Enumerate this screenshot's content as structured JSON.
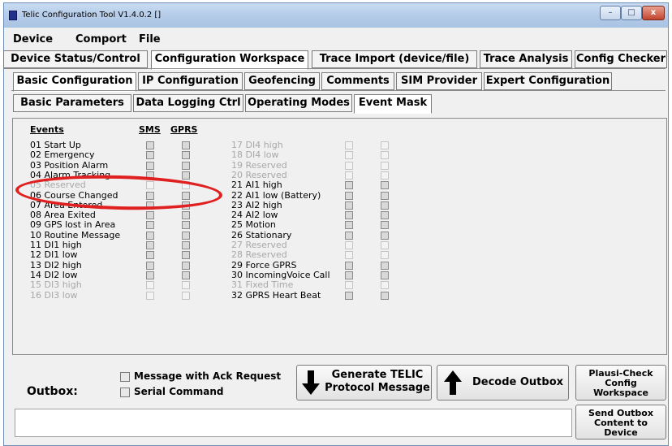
{
  "window": {
    "title": "Telic Configuration Tool V1.4.0.2 []"
  },
  "menu": [
    "Device",
    "Comport",
    "File"
  ],
  "tabs_main": [
    "Device Status/Control",
    "Configuration Workspace",
    "Trace Import (device/file)",
    "Trace Analysis",
    "Config Checker"
  ],
  "tabs_config": [
    "Basic Configuration",
    "IP Configuration",
    "Geofencing",
    "Comments",
    "SIM Provider",
    "Expert Configuration"
  ],
  "tabs_basic": [
    "Basic Parameters",
    "Data Logging Ctrl",
    "Operating Modes",
    "Event Mask"
  ],
  "headers": {
    "events": "Events",
    "sms": "SMS",
    "gprs": "GPRS"
  },
  "events_left": [
    {
      "label": "01 Start Up",
      "enabled": true
    },
    {
      "label": "02 Emergency",
      "enabled": true
    },
    {
      "label": "03 Position Alarm",
      "enabled": true
    },
    {
      "label": "04 Alarm Tracking",
      "enabled": true
    },
    {
      "label": "05 Reserved",
      "enabled": false
    },
    {
      "label": "06 Course Changed",
      "enabled": true
    },
    {
      "label": "07 Area Entered",
      "enabled": true
    },
    {
      "label": "08 Area Exited",
      "enabled": true
    },
    {
      "label": "09 GPS lost in Area",
      "enabled": true
    },
    {
      "label": "10 Routine Message",
      "enabled": true
    },
    {
      "label": "11 DI1 high",
      "enabled": true
    },
    {
      "label": "12 DI1 low",
      "enabled": true
    },
    {
      "label": "13 DI2 high",
      "enabled": true
    },
    {
      "label": "14 DI2 low",
      "enabled": true
    },
    {
      "label": "15 DI3 high",
      "enabled": false
    },
    {
      "label": "16 DI3 low",
      "enabled": false
    }
  ],
  "events_right": [
    {
      "label": "17 DI4 high",
      "enabled": false
    },
    {
      "label": "18 DI4 low",
      "enabled": false
    },
    {
      "label": "19 Reserved",
      "enabled": false
    },
    {
      "label": "20 Reserved",
      "enabled": false
    },
    {
      "label": "21 AI1 high",
      "enabled": true
    },
    {
      "label": "22 AI1 low (Battery)",
      "enabled": true
    },
    {
      "label": "23 AI2 high",
      "enabled": true
    },
    {
      "label": "24 AI2 low",
      "enabled": true
    },
    {
      "label": "25 Motion",
      "enabled": true
    },
    {
      "label": "26 Stationary",
      "enabled": true
    },
    {
      "label": "27 Reserved",
      "enabled": false
    },
    {
      "label": "28 Reserved",
      "enabled": false
    },
    {
      "label": "29 Force GPRS",
      "enabled": true
    },
    {
      "label": "30 IncomingVoice Call",
      "enabled": true
    },
    {
      "label": "31 Fixed Time",
      "enabled": false
    },
    {
      "label": "32 GPRS Heart Beat",
      "enabled": true
    }
  ],
  "outbox": {
    "label": "Outbox:",
    "ack_label": "Message with Ack Request",
    "serial_label": "Serial Command",
    "generate_line1": "Generate TELIC",
    "generate_line2": "Protocol Message",
    "decode": "Decode Outbox",
    "plausi_line1": "Plausi-Check",
    "plausi_line2": "Config",
    "plausi_line3": "Workspace",
    "send_line1": "Send Outbox",
    "send_line2": "Content to",
    "send_line3": "Device",
    "text": ""
  },
  "colors": {
    "annotation": "#e02020",
    "titlebar": "#b7cde9"
  },
  "icons": [
    "app-icon",
    "minimize-icon",
    "maximize-icon",
    "close-icon",
    "arrow-down-icon",
    "arrow-up-icon"
  ]
}
